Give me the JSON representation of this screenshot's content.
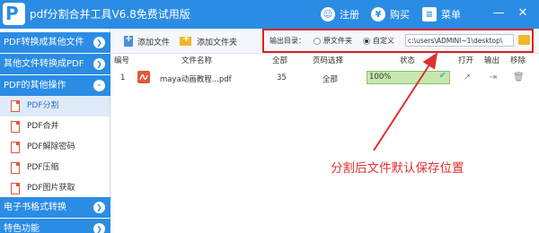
{
  "app": {
    "title": "pdf分割合并工具V6.8免费试用版",
    "logo_letter": "P"
  },
  "header": {
    "register_label": "注册",
    "buy_label": "购买",
    "menu_label": "菜单",
    "minimize_glyph": "—",
    "close_glyph": "✕"
  },
  "sidebar": {
    "sections": [
      {
        "label": "PDF转换成其他文件"
      },
      {
        "label": "其他文件转换成PDF"
      },
      {
        "label": "PDF的其他操作"
      },
      {
        "label": "电子书格式转换"
      },
      {
        "label": "特色功能"
      }
    ],
    "sub_items": [
      {
        "label": "PDF分割",
        "active": true
      },
      {
        "label": "PDF合并"
      },
      {
        "label": "PDF解除密码"
      },
      {
        "label": "PDF压缩"
      },
      {
        "label": "PDF图片获取"
      }
    ],
    "arrow_right": "❯",
    "arrow_down": "⌄"
  },
  "toolbar": {
    "add_file_label": "添加文件",
    "add_folder_label": "添加文件夹",
    "output_dir_label": "输出目录：",
    "option_original_label": "原文件夹",
    "option_custom_label": "自定义",
    "selected_option": "自定义",
    "path_value": "c:\\users\\ADMINI~1\\desktop\\"
  },
  "table": {
    "columns": {
      "num": "编号",
      "filename": "文件名称",
      "total": "全部",
      "page_select": "页码选择",
      "status": "状态",
      "open": "打开",
      "output": "输出",
      "remove": "移除"
    },
    "rows": [
      {
        "num": "1",
        "filename": "maya动画教程...pdf",
        "total": "35",
        "page_select": "全部",
        "progress_text": "100%",
        "progress": 1.0
      }
    ]
  },
  "annotation": {
    "text": "分割后文件默认保存位置"
  },
  "colors": {
    "accent": "#2b8ce4",
    "highlight": "#e02020",
    "progress": "#c6e8ae"
  },
  "icons": [
    "logo-icon",
    "register-icon",
    "buy-icon",
    "menu-icon",
    "minimize-icon",
    "close-icon",
    "add-file-icon",
    "add-folder-icon",
    "folder-browse-icon",
    "pdf-file-icon",
    "open-icon",
    "output-icon",
    "trash-icon",
    "check-icon"
  ]
}
